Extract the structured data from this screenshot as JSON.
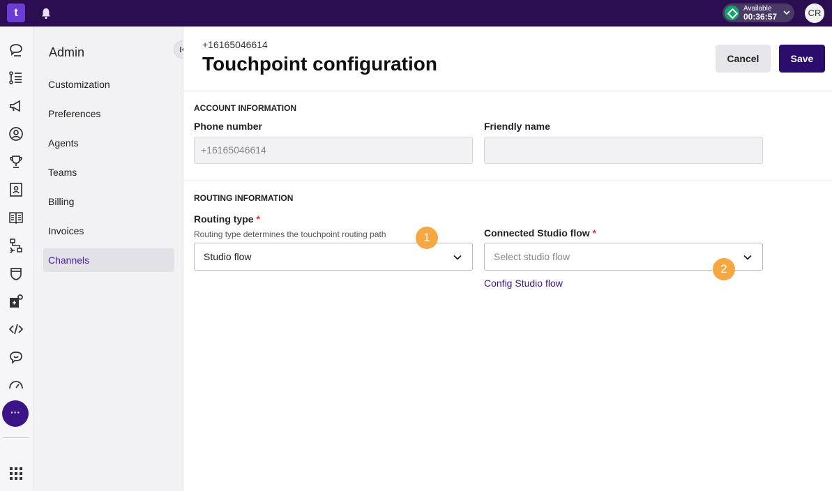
{
  "topbar": {
    "logo_text": "t",
    "status_label": "Available",
    "status_time": "00:36:57",
    "avatar_initials": "CR"
  },
  "rail": {
    "icons": [
      "conversations-icon",
      "queues-icon",
      "campaigns-icon",
      "contacts-icon",
      "trophy-icon",
      "directory-icon",
      "knowledge-book-icon",
      "workflow-icon",
      "shield-icon",
      "integrations-icon",
      "code-icon",
      "chat-icon",
      "dashboard-icon"
    ],
    "more_label": "···",
    "apps_icon": "grid-icon"
  },
  "sidebar": {
    "title": "Admin",
    "items": [
      {
        "label": "Customization"
      },
      {
        "label": "Preferences"
      },
      {
        "label": "Agents"
      },
      {
        "label": "Teams"
      },
      {
        "label": "Billing"
      },
      {
        "label": "Invoices"
      },
      {
        "label": "Channels",
        "active": true
      }
    ]
  },
  "main": {
    "subtitle": "+16165046614",
    "title": "Touchpoint configuration",
    "cancel_label": "Cancel",
    "save_label": "Save",
    "account_section": {
      "title": "ACCOUNT INFORMATION",
      "phone_label": "Phone number",
      "phone_value": "+16165046614",
      "friendly_label": "Friendly name",
      "friendly_value": ""
    },
    "routing_section": {
      "title": "ROUTING INFORMATION",
      "routing_label": "Routing type",
      "required_mark": "*",
      "routing_help": "Routing type determines the touchpoint routing path",
      "routing_value": "Studio flow",
      "studio_label": "Connected Studio flow",
      "studio_placeholder": "Select studio flow",
      "config_link": "Config Studio flow"
    },
    "badges": [
      "1",
      "2"
    ]
  },
  "colors": {
    "topbar": "#2b0d52",
    "accent": "#3b1487",
    "save_button": "#2b0d6e",
    "badge": "#f5a742",
    "status_available": "#14a06b"
  }
}
